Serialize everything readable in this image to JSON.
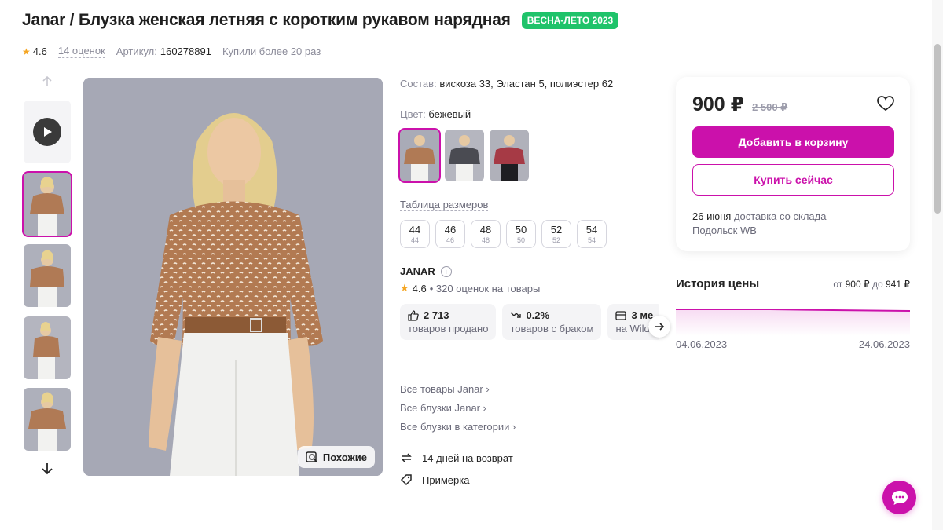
{
  "product": {
    "title": "Janar / Блузка женская летняя с коротким рукавом нарядная",
    "badge": "ВЕСНА-ЛЕТО 2023",
    "rating": "4.6",
    "reviews": "14 оценок",
    "article_label": "Артикул:",
    "article_value": "160278891",
    "bought": "Купили более 20 раз"
  },
  "gallery": {
    "similar_label": "Похожие"
  },
  "details": {
    "composition_label": "Состав:",
    "composition_value": "вискоза 33, Эластан 5, полиэстер 62",
    "color_label": "Цвет:",
    "color_value": "бежевый",
    "size_table": "Таблица размеров",
    "sizes": [
      {
        "main": "44",
        "sub": "44"
      },
      {
        "main": "46",
        "sub": "46"
      },
      {
        "main": "48",
        "sub": "48"
      },
      {
        "main": "50",
        "sub": "50"
      },
      {
        "main": "52",
        "sub": "52"
      },
      {
        "main": "54",
        "sub": "54"
      }
    ],
    "brand": "JANAR",
    "brand_rating": "4.6",
    "brand_reviews": "• 320 оценок на товары",
    "stats": [
      {
        "value": "2 713",
        "label": "товаров продано"
      },
      {
        "value": "0.2%",
        "label": "товаров с браком"
      },
      {
        "value": "3 ме",
        "label": "на Wildb"
      }
    ],
    "links": [
      "Все товары Janar ›",
      "Все блузки Janar ›",
      "Все блузки в категории ›"
    ],
    "return": "14 дней на возврат",
    "fitting": "Примерка"
  },
  "buy": {
    "price": "900 ₽",
    "old_price": "2 500 ₽",
    "cart_button": "Добавить в корзину",
    "buy_button": "Купить сейчас",
    "delivery_date": "26 июня",
    "delivery_text": "доставка со склада",
    "warehouse": "Подольск WB"
  },
  "history": {
    "title": "История цены",
    "range_from_label": "от",
    "range_from": "900 ₽",
    "range_to_label": "до",
    "range_to": "941 ₽",
    "date_start": "04.06.2023",
    "date_end": "24.06.2023"
  },
  "colors": {
    "accent": "#cb11ab",
    "badge": "#1fc36a"
  }
}
